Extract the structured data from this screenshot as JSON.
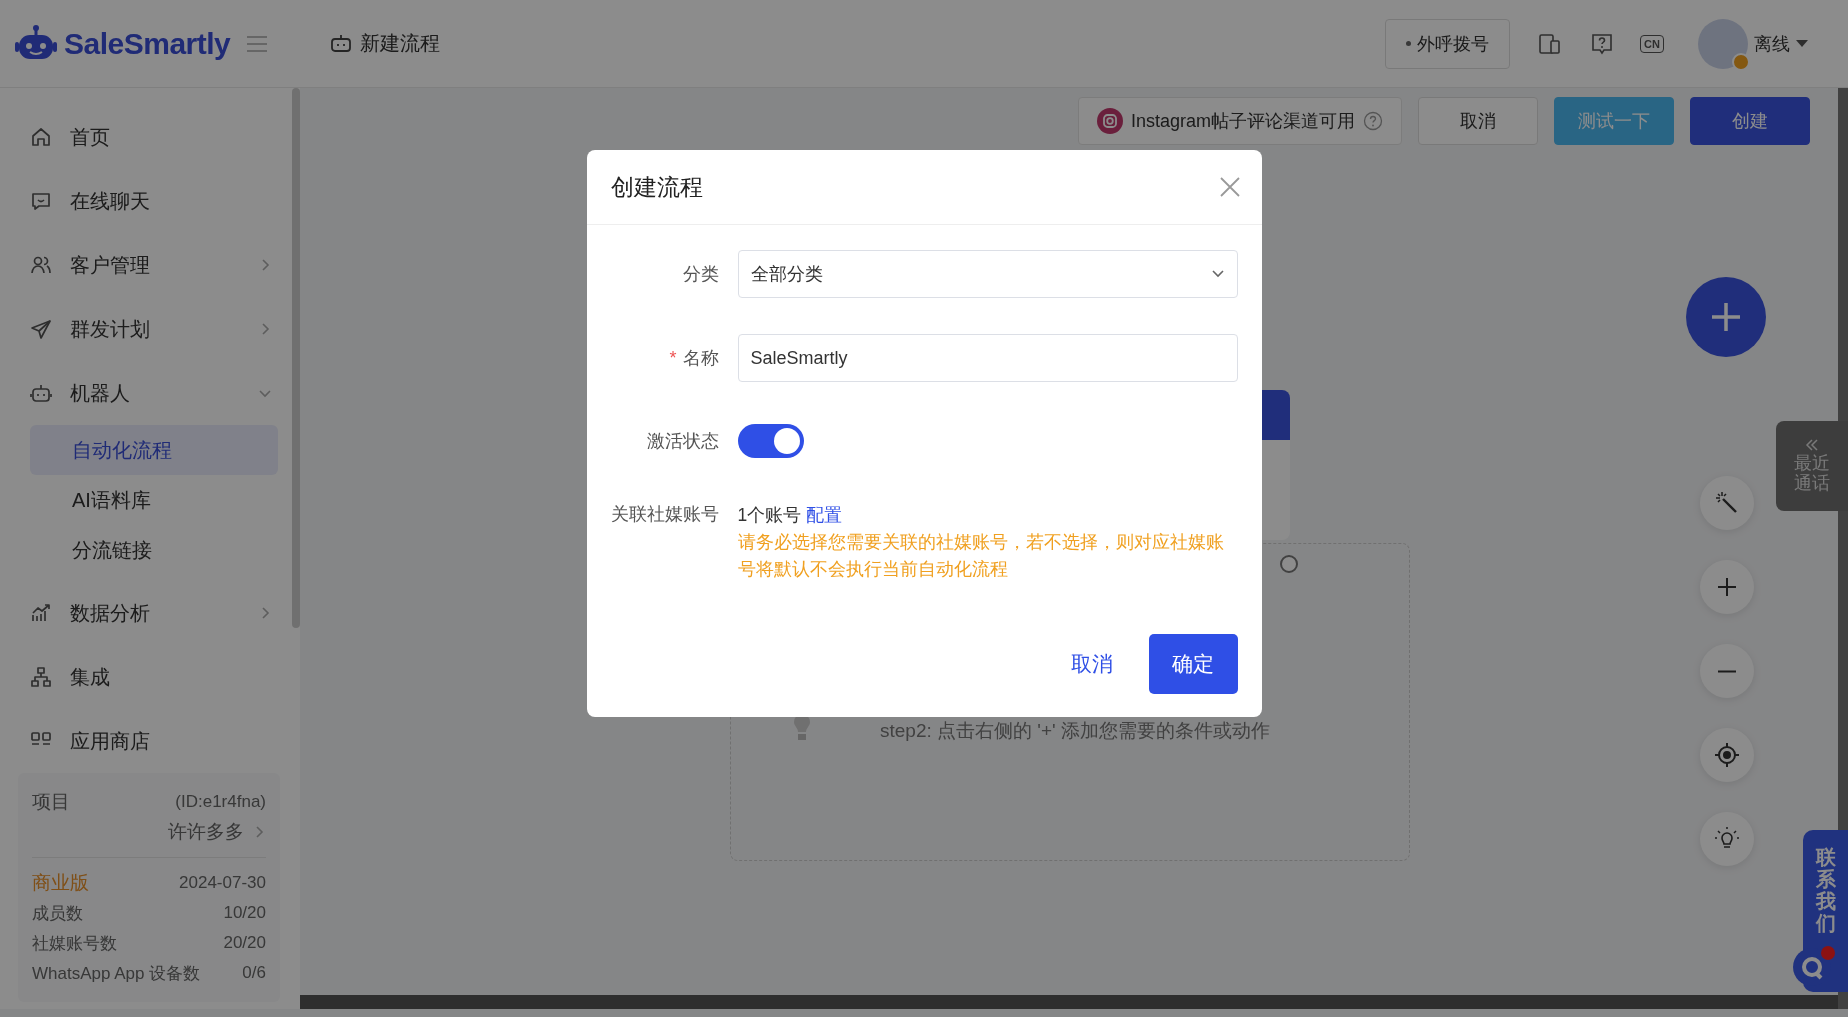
{
  "brand": {
    "name": "SaleSmartly"
  },
  "header": {
    "page_title": "新建流程",
    "dial_button": "外呼拨号",
    "language_badge": "CN",
    "user_status": "离线"
  },
  "sidebar": {
    "items": [
      {
        "label": "首页",
        "kind": "link"
      },
      {
        "label": "在线聊天",
        "kind": "link"
      },
      {
        "label": "客户管理",
        "kind": "group",
        "expanded": false
      },
      {
        "label": "群发计划",
        "kind": "group",
        "expanded": false
      },
      {
        "label": "机器人",
        "kind": "group",
        "expanded": true,
        "children": [
          {
            "label": "自动化流程",
            "selected": true
          },
          {
            "label": "AI语料库",
            "selected": false
          },
          {
            "label": "分流链接",
            "selected": false
          }
        ]
      },
      {
        "label": "数据分析",
        "kind": "group",
        "expanded": false
      },
      {
        "label": "集成",
        "kind": "link"
      },
      {
        "label": "应用商店",
        "kind": "link"
      }
    ],
    "project": {
      "label": "项目",
      "id": "(ID:e1r4fna)",
      "name": "许许多多",
      "plan": "商业版",
      "expiry": "2024-07-30",
      "stats": [
        {
          "label": "成员数",
          "value": "10/20"
        },
        {
          "label": "社媒账号数",
          "value": "20/20"
        },
        {
          "label": "WhatsApp App 设备数",
          "value": "0/6"
        }
      ]
    }
  },
  "toolbar": {
    "channel_notice": "Instagram帖子评论渠道可用",
    "buttons": [
      {
        "label": "取消",
        "kind": "default"
      },
      {
        "label": "测试一下",
        "kind": "test"
      },
      {
        "label": "创建",
        "kind": "primary"
      }
    ]
  },
  "canvas": {
    "hint": "step2: 点击右侧的 '+' 添加您需要的条件或动作"
  },
  "side_tabs": {
    "recent_calls": "最近通话",
    "contact_us": "联系我们"
  },
  "dialog": {
    "title": "创建流程",
    "fields": [
      {
        "kind": "select",
        "label": "分类",
        "value": "全部分类"
      },
      {
        "kind": "input",
        "label": "名称",
        "value": "SaleSmartly",
        "required_mark": "*"
      },
      {
        "kind": "switch",
        "label": "激活状态",
        "on": true
      },
      {
        "kind": "accounts",
        "label": "关联社媒账号",
        "value": "1个账号",
        "link": "配置",
        "warning": "请务必选择您需要关联的社媒账号，若不选择，则对应社媒账号将默认不会执行当前自动化流程"
      }
    ],
    "cancel": "取消",
    "confirm": "确定"
  }
}
